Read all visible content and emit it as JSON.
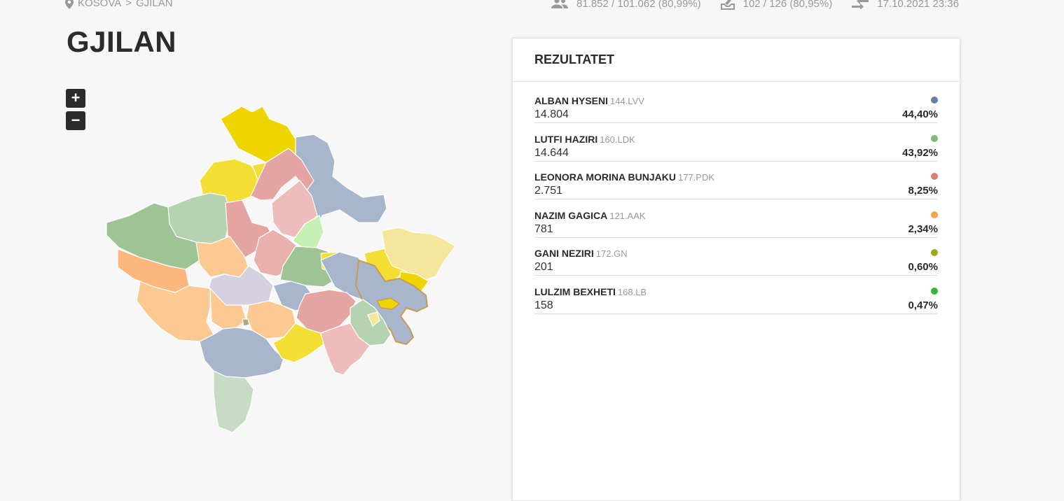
{
  "breadcrumb": {
    "country": "KOSOVA",
    "separator": ">",
    "municipality": "GJILAN"
  },
  "stats": {
    "voters": "81.852 / 101.062 (80,99%)",
    "stations": "102 / 126 (80,95%)",
    "updated": "17.10.2021 23:36"
  },
  "page_title": "GJILAN",
  "zoom": {
    "in_label": "+",
    "out_label": "−"
  },
  "results": {
    "title": "REZULTATET",
    "candidates": [
      {
        "name": "ALBAN HYSENI",
        "party": "144.LVV",
        "votes": "14.804",
        "percent": "44,40%",
        "color": "#6b7fa3"
      },
      {
        "name": "LUTFI HAZIRI",
        "party": "160.LDK",
        "votes": "14.644",
        "percent": "43,92%",
        "color": "#7fb77e"
      },
      {
        "name": "LEONORA MORINA BUNJAKU",
        "party": "177.PDK",
        "votes": "2.751",
        "percent": "8,25%",
        "color": "#e07b75"
      },
      {
        "name": "NAZIM GAGICA",
        "party": "121.AAK",
        "votes": "781",
        "percent": "2,34%",
        "color": "#f5a44a"
      },
      {
        "name": "GANI NEZIRI",
        "party": "172.GN",
        "votes": "201",
        "percent": "0,60%",
        "color": "#a3a817"
      },
      {
        "name": "LULZIM BEXHETI",
        "party": "168.LB",
        "votes": "158",
        "percent": "0,47%",
        "color": "#34b534"
      }
    ]
  }
}
